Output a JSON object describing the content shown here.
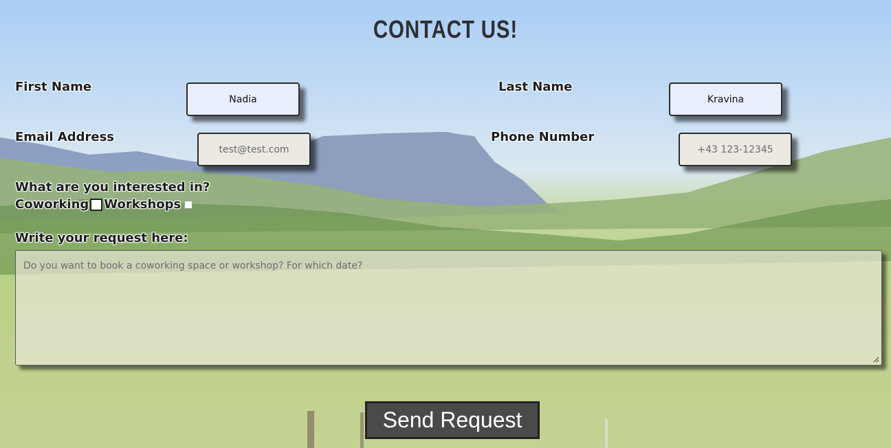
{
  "page": {
    "title": "CONTACT US!"
  },
  "form": {
    "first_name": {
      "label": "First Name",
      "value": "Nadia"
    },
    "last_name": {
      "label": "Last Name",
      "value": "Kravina"
    },
    "email": {
      "label": "Email Address",
      "placeholder": "test@test.com"
    },
    "phone": {
      "label": "Phone Number",
      "placeholder": "+43 123-12345"
    },
    "interests": {
      "question": "What are you interested in?",
      "options": [
        {
          "label": "Coworking",
          "checked": false
        },
        {
          "label": "Workshops",
          "checked": false
        }
      ]
    },
    "request": {
      "label": "Write your request here:",
      "placeholder": "Do you want to book a coworking space or workshop? For which date?"
    },
    "submit_label": "Send Request"
  }
}
